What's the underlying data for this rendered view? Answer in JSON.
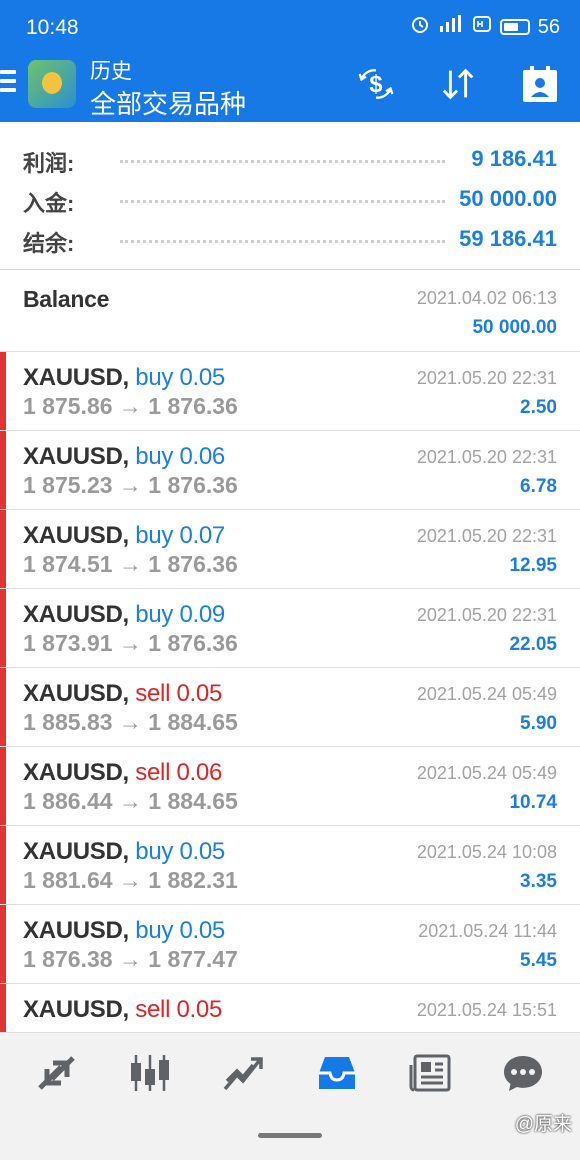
{
  "status": {
    "time": "10:48",
    "battery": "56"
  },
  "header": {
    "title": "历史",
    "subtitle": "全部交易品种"
  },
  "summary": [
    {
      "label": "利润:",
      "value": "9 186.41"
    },
    {
      "label": "入金:",
      "value": "50 000.00"
    },
    {
      "label": "结余:",
      "value": "59 186.41"
    }
  ],
  "balance": {
    "label": "Balance",
    "date": "2021.04.02 06:13",
    "amount": "50 000.00"
  },
  "trades": [
    {
      "symbol": "XAUUSD,",
      "side": "buy 0.05",
      "prices": "1 875.86 → 1 876.36",
      "date": "2021.05.20 22:31",
      "profit": "2.50"
    },
    {
      "symbol": "XAUUSD,",
      "side": "buy 0.06",
      "prices": "1 875.23 → 1 876.36",
      "date": "2021.05.20 22:31",
      "profit": "6.78"
    },
    {
      "symbol": "XAUUSD,",
      "side": "buy 0.07",
      "prices": "1 874.51 → 1 876.36",
      "date": "2021.05.20 22:31",
      "profit": "12.95"
    },
    {
      "symbol": "XAUUSD,",
      "side": "buy 0.09",
      "prices": "1 873.91 → 1 876.36",
      "date": "2021.05.20 22:31",
      "profit": "22.05"
    },
    {
      "symbol": "XAUUSD,",
      "side": "sell 0.05",
      "prices": "1 885.83 → 1 884.65",
      "date": "2021.05.24 05:49",
      "profit": "5.90"
    },
    {
      "symbol": "XAUUSD,",
      "side": "sell 0.06",
      "prices": "1 886.44 → 1 884.65",
      "date": "2021.05.24 05:49",
      "profit": "10.74"
    },
    {
      "symbol": "XAUUSD,",
      "side": "buy 0.05",
      "prices": "1 881.64 → 1 882.31",
      "date": "2021.05.24 10:08",
      "profit": "3.35"
    },
    {
      "symbol": "XAUUSD,",
      "side": "buy 0.05",
      "prices": "1 876.38 → 1 877.47",
      "date": "2021.05.24 11:44",
      "profit": "5.45"
    },
    {
      "symbol": "XAUUSD,",
      "side": "sell 0.05",
      "prices": "",
      "date": "2021.05.24 15:51",
      "profit": ""
    }
  ],
  "colors": {
    "accent": "#1779e6",
    "buy": "#1a7fe0",
    "sell": "#d92727",
    "marker": "#e23434"
  },
  "watermark": "@原来"
}
